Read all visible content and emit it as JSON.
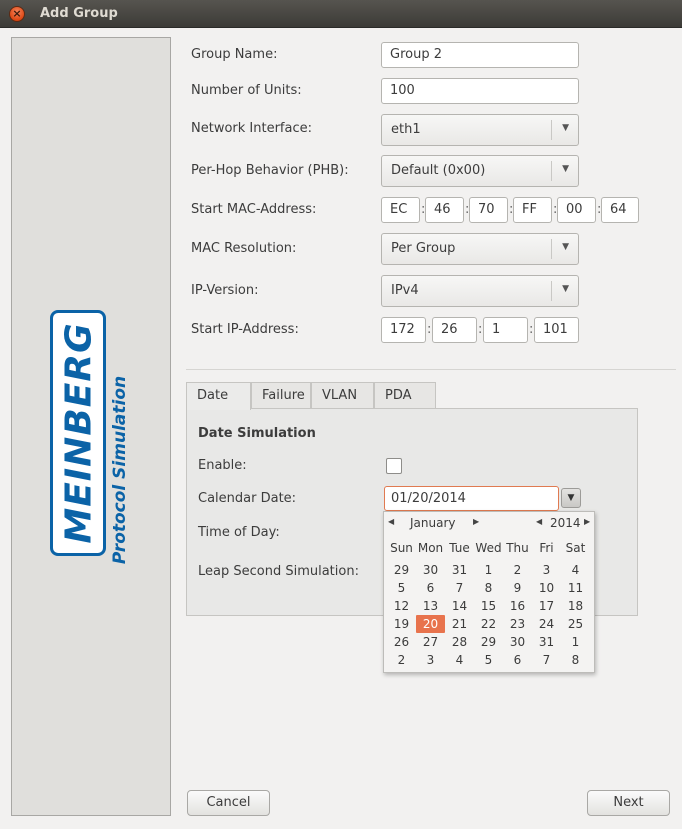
{
  "window": {
    "title": "Add Group"
  },
  "form": {
    "group_name": {
      "label": "Group Name:",
      "value": "Group 2"
    },
    "num_units": {
      "label": "Number of Units:",
      "value": "100"
    },
    "network_interface": {
      "label": "Network Interface:",
      "value": "eth1"
    },
    "phb": {
      "label": "Per-Hop Behavior (PHB):",
      "value": "Default (0x00)"
    },
    "start_mac": {
      "label": "Start MAC-Address:",
      "octets": [
        "EC",
        "46",
        "70",
        "FF",
        "00",
        "64"
      ]
    },
    "mac_resolution": {
      "label": "MAC Resolution:",
      "value": "Per Group"
    },
    "ip_version": {
      "label": "IP-Version:",
      "value": "IPv4"
    },
    "start_ip": {
      "label": "Start IP-Address:",
      "octets": [
        "172",
        "26",
        "1",
        "101"
      ]
    }
  },
  "tabs": [
    "Date",
    "Failure",
    "VLAN",
    "PDA"
  ],
  "date_panel": {
    "title": "Date Simulation",
    "enable_label": "Enable:",
    "calendar_label": "Calendar Date:",
    "calendar_value": "01/20/2014",
    "time_label": "Time of Day:",
    "leap_label": "Leap Second Simulation:"
  },
  "calendar": {
    "month": "January",
    "year": "2014",
    "weekdays": [
      "Sun",
      "Mon",
      "Tue",
      "Wed",
      "Thu",
      "Fri",
      "Sat"
    ],
    "weeks": [
      [
        "29",
        "30",
        "31",
        "1",
        "2",
        "3",
        "4"
      ],
      [
        "5",
        "6",
        "7",
        "8",
        "9",
        "10",
        "11"
      ],
      [
        "12",
        "13",
        "14",
        "15",
        "16",
        "17",
        "18"
      ],
      [
        "19",
        "20",
        "21",
        "22",
        "23",
        "24",
        "25"
      ],
      [
        "26",
        "27",
        "28",
        "29",
        "30",
        "31",
        "1"
      ],
      [
        "2",
        "3",
        "4",
        "5",
        "6",
        "7",
        "8"
      ]
    ],
    "selected": "20"
  },
  "logo": {
    "brand": "MEINBERG",
    "subtitle": "Protocol Simulation"
  },
  "buttons": {
    "cancel": "Cancel",
    "next": "Next"
  },
  "colors": {
    "accent": "#e8734d",
    "brand": "#0b63a7"
  }
}
